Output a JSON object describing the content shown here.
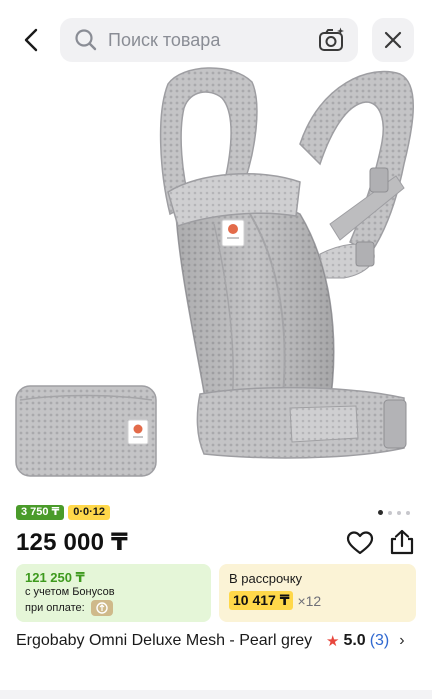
{
  "header": {
    "search_placeholder": "Поиск товара"
  },
  "gallery": {
    "slides_total": 4,
    "active_slide": 1
  },
  "product": {
    "badges": {
      "bonus": "3 750 ₸",
      "installment": "0·0·12"
    },
    "price": "125 000 ₸",
    "bonus_card": {
      "amount": "121 250 ₸",
      "line1": "с учетом Бонусов",
      "line2": "при оплате:"
    },
    "installment_card": {
      "label": "В рассрочку",
      "monthly": "10 417 ₸",
      "multiplier": "×12"
    },
    "title": "Ergobaby Omni Deluxe Mesh - Pearl grey",
    "rating": {
      "score": "5.0",
      "count": "(3)"
    }
  },
  "colors": {
    "bonus_green": "#4a9b2a",
    "installment_yellow": "#ffd84a",
    "rating_star": "#e8473d",
    "link_blue": "#2f68d0"
  },
  "icons": [
    "back-arrow-icon",
    "search-icon",
    "camera-search-icon",
    "close-icon",
    "heart-icon",
    "share-icon",
    "star-icon",
    "chevron-right-icon"
  ]
}
